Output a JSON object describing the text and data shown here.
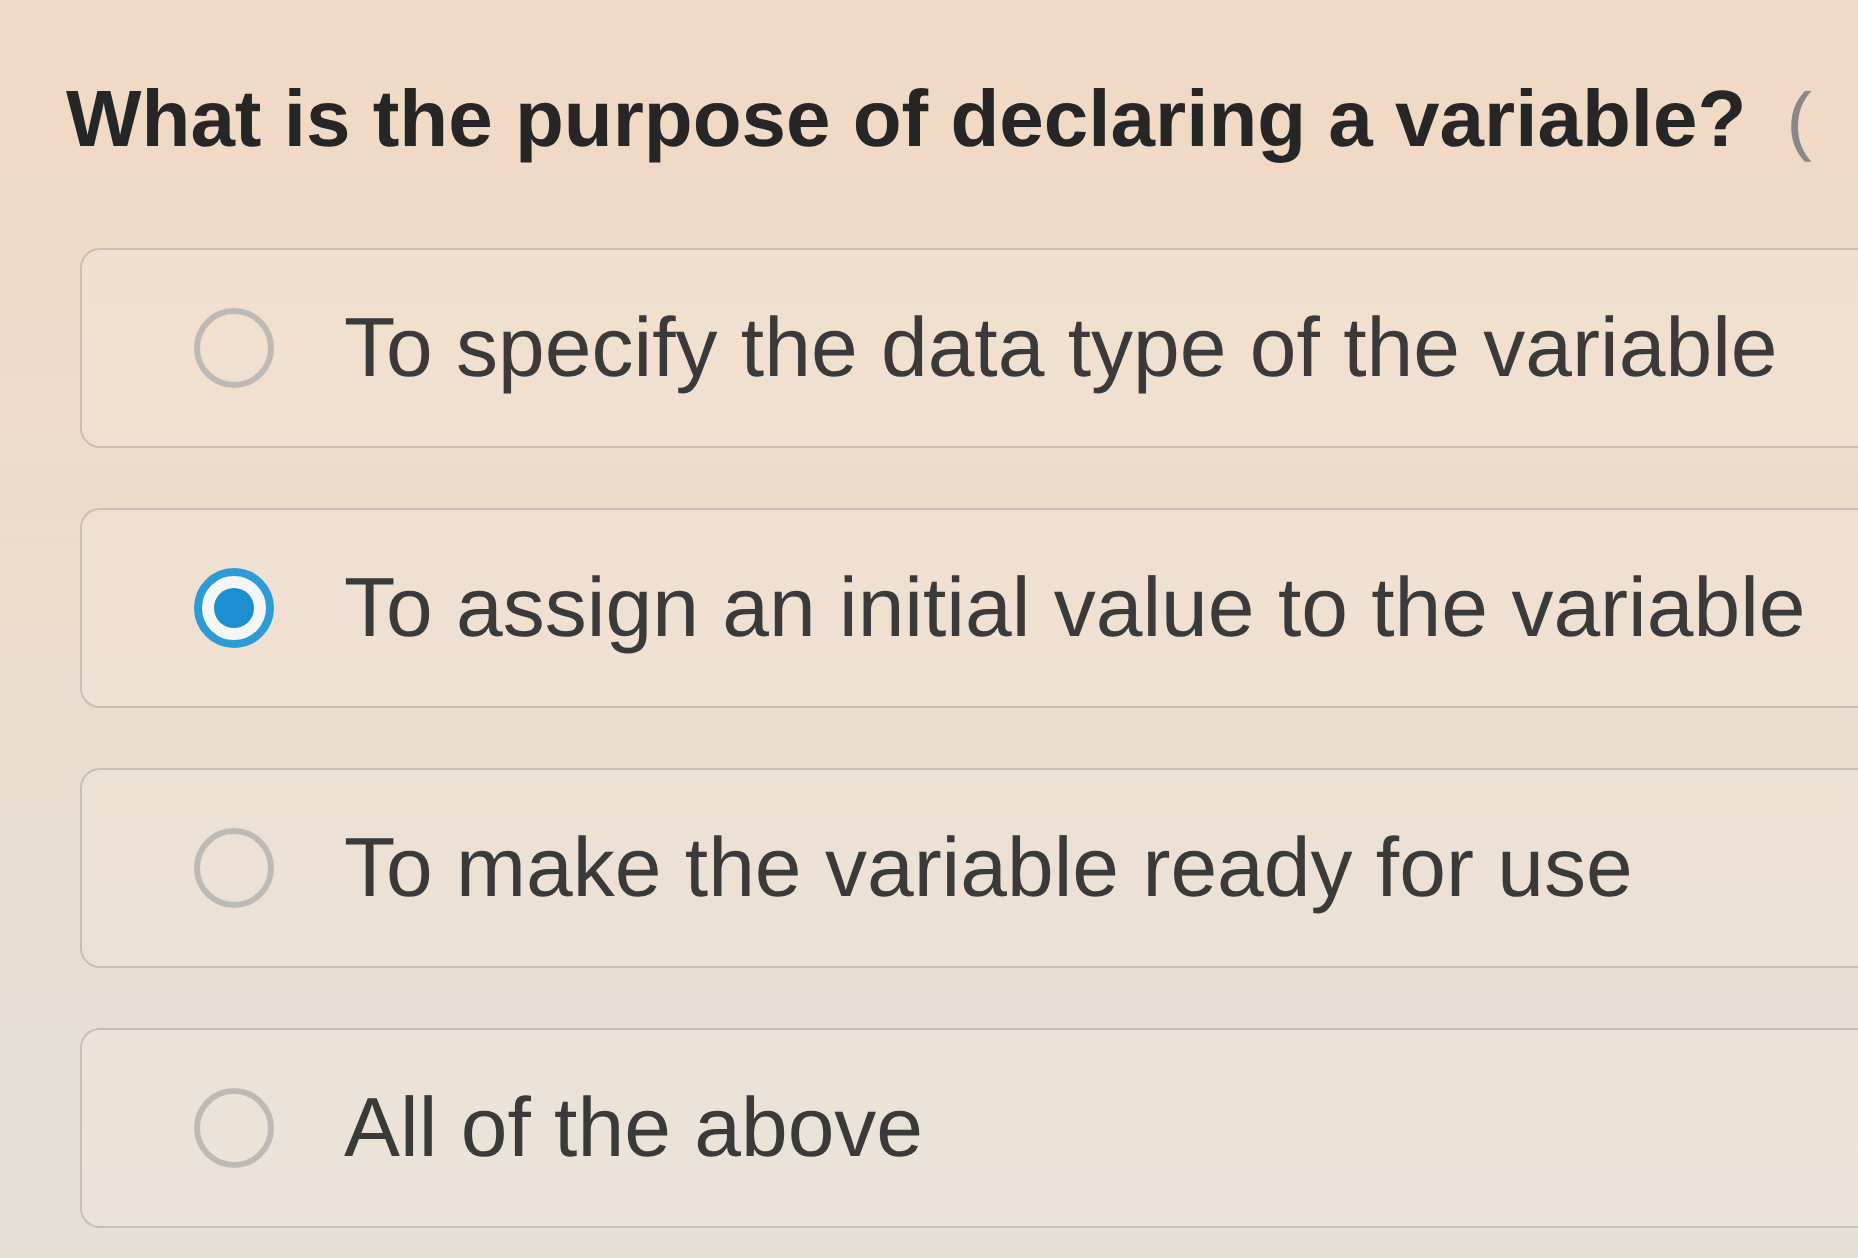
{
  "question": {
    "text": "What is the purpose of declaring a variable?",
    "trailing": "("
  },
  "options": [
    {
      "label": "To specify the data type of the variable",
      "selected": false
    },
    {
      "label": "To assign an initial value to the variable",
      "selected": true
    },
    {
      "label": "To make the variable ready for use",
      "selected": false
    },
    {
      "label": "All of the above",
      "selected": false
    }
  ]
}
